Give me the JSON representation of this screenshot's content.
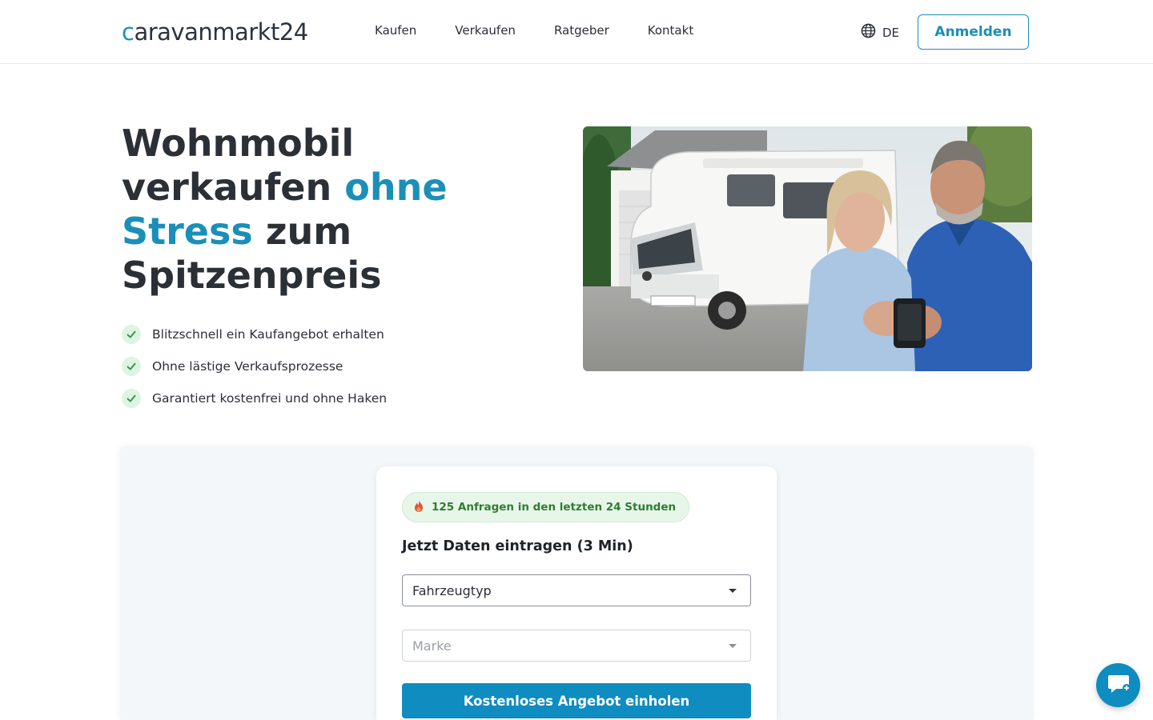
{
  "header": {
    "logo": {
      "prefix": "c",
      "main": "aravanmarkt",
      "num": "24"
    },
    "nav": [
      "Kaufen",
      "Verkaufen",
      "Ratgeber",
      "Kontakt"
    ],
    "language": "DE",
    "login_label": "Anmelden"
  },
  "hero": {
    "title_line1": "Wohnmobil",
    "title_line2_start": "verkaufen ",
    "title_accent_1": "ohne",
    "title_accent_2": "Stress",
    "title_line3_end": " zum",
    "title_line4": "Spitzenpreis",
    "benefits": [
      "Blitzschnell ein Kaufangebot erhalten",
      "Ohne lästige Verkaufsprozesse",
      "Garantiert kostenfrei und ohne Haken"
    ]
  },
  "form": {
    "badge_text": "125 Anfragen in den letzten 24 Stunden",
    "title": "Jetzt Daten eintragen (3 Min)",
    "vehicle_type": "Fahrzeugtyp",
    "brand_placeholder": "Marke",
    "cta_label": "Kostenloses Angebot einholen"
  },
  "icons": {
    "language": "globe-icon",
    "check": "check-icon",
    "badge": "flame-icon",
    "chat": "chat-icon"
  },
  "colors": {
    "accent": "#1a8fb8",
    "cta": "#0f8cc0",
    "badge_bg": "#e8f6ea",
    "badge_text": "#2e7d32",
    "text": "#2b2f36"
  }
}
